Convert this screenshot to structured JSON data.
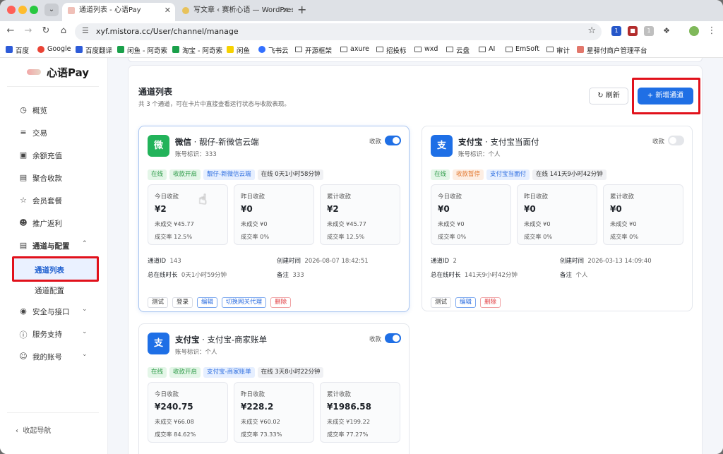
{
  "browser": {
    "tabs": [
      {
        "title": "通道列表 - 心语Pay",
        "active": true
      },
      {
        "title": "写文章 ‹ 赛析心语 — WordPress",
        "active": false
      }
    ],
    "url": "xyf.mistora.cc/User/channel/manage",
    "bookmarks": [
      "百度",
      "Google",
      "百度翻译",
      "闲鱼 - 阿奇索",
      "淘宝 - 阿奇索",
      "闲鱼",
      "飞书云",
      "开源框架",
      "axure",
      "招投标",
      "wxd",
      "云盘",
      "AI",
      "EmSoft",
      "审计",
      "星驿付商户管理平台"
    ],
    "ext_badges": [
      "1",
      "1"
    ]
  },
  "sidebar": {
    "brand": "心语Pay",
    "items": [
      {
        "label": "概览",
        "icon": "gauge-icon"
      },
      {
        "label": "交易",
        "icon": "list-icon"
      },
      {
        "label": "余额充值",
        "icon": "wallet-icon"
      },
      {
        "label": "聚合收款",
        "icon": "card-icon"
      },
      {
        "label": "会员套餐",
        "icon": "star-icon"
      },
      {
        "label": "推广返利",
        "icon": "users-icon"
      },
      {
        "label": "通道与配置",
        "icon": "server-icon"
      }
    ],
    "subitems": [
      "通道列表",
      "通道配置"
    ],
    "bottom_items": [
      {
        "label": "安全与接口",
        "icon": "lock-icon"
      },
      {
        "label": "服务支持",
        "icon": "help-icon"
      },
      {
        "label": "我的账号",
        "icon": "user-icon"
      }
    ],
    "collapse": "收起导航"
  },
  "page": {
    "title": "通道列表",
    "subtitle": "共 3 个通道，可在卡片中直接查看运行状态与收款表现。",
    "refresh": "刷新",
    "add": "新增通道"
  },
  "labels": {
    "collect": "收款",
    "today": "今日收款",
    "yesterday": "昨日收款",
    "total": "累计收款",
    "channel_id": "通道ID",
    "created": "创建时间",
    "online_total": "总在线时长",
    "note": "备注"
  },
  "cards": [
    {
      "avatar": "微",
      "color": "#22b35a",
      "name": "微信",
      "sub": "靓仔-新微信云端",
      "account": "账号标识：333",
      "enabled": true,
      "tags": [
        {
          "text": "在线",
          "kind": "green"
        },
        {
          "text": "收款开启",
          "kind": "green"
        },
        {
          "text": "靓仔-新微信云端",
          "kind": "blue"
        },
        {
          "text": "在线 0天1小时58分钟",
          "kind": "gray"
        }
      ],
      "stats": [
        {
          "value": "¥2",
          "unsettled": "未成交 ¥45.77",
          "rate": "成交率 12.5%"
        },
        {
          "value": "¥0",
          "unsettled": "未成交 ¥0",
          "rate": "成交率 0%"
        },
        {
          "value": "¥2",
          "unsettled": "未成交 ¥45.77",
          "rate": "成交率 12.5%"
        }
      ],
      "id": "143",
      "created": "2026-08-07 18:42:51",
      "online_total": "0天1小时59分钟",
      "note": "333",
      "actions": [
        {
          "text": "测试",
          "kind": ""
        },
        {
          "text": "登录",
          "kind": ""
        },
        {
          "text": "编辑",
          "kind": "b"
        },
        {
          "text": "切换网关代理",
          "kind": "b"
        },
        {
          "text": "删除",
          "kind": "r"
        }
      ]
    },
    {
      "avatar": "支",
      "color": "#1e6fe6",
      "name": "支付宝",
      "sub": "支付宝当面付",
      "account": "账号标识：个人",
      "enabled": false,
      "tags": [
        {
          "text": "在线",
          "kind": "green"
        },
        {
          "text": "收款暂停",
          "kind": "orange"
        },
        {
          "text": "支付宝当面付",
          "kind": "blue"
        },
        {
          "text": "在线 141天9小时42分钟",
          "kind": "gray"
        }
      ],
      "stats": [
        {
          "value": "¥0",
          "unsettled": "未成交 ¥0",
          "rate": "成交率 0%"
        },
        {
          "value": "¥0",
          "unsettled": "未成交 ¥0",
          "rate": "成交率 0%"
        },
        {
          "value": "¥0",
          "unsettled": "未成交 ¥0",
          "rate": "成交率 0%"
        }
      ],
      "id": "2",
      "created": "2026-03-13 14:09:40",
      "online_total": "141天9小时42分钟",
      "note": "个人",
      "actions": [
        {
          "text": "测试",
          "kind": ""
        },
        {
          "text": "编辑",
          "kind": "b"
        },
        {
          "text": "删除",
          "kind": "r"
        }
      ]
    },
    {
      "avatar": "支",
      "color": "#1e6fe6",
      "name": "支付宝",
      "sub": "支付宝-商家账单",
      "account": "账号标识：个人",
      "enabled": true,
      "tags": [
        {
          "text": "在线",
          "kind": "green"
        },
        {
          "text": "收款开启",
          "kind": "green"
        },
        {
          "text": "支付宝-商家账单",
          "kind": "blue"
        },
        {
          "text": "在线 3天8小时22分钟",
          "kind": "gray"
        }
      ],
      "stats": [
        {
          "value": "¥240.75",
          "unsettled": "未成交 ¥66.08",
          "rate": "成交率 84.62%"
        },
        {
          "value": "¥228.2",
          "unsettled": "未成交 ¥60.02",
          "rate": "成交率 73.33%"
        },
        {
          "value": "¥1986.58",
          "unsettled": "未成交 ¥199.22",
          "rate": "成交率 77.27%"
        }
      ]
    }
  ]
}
